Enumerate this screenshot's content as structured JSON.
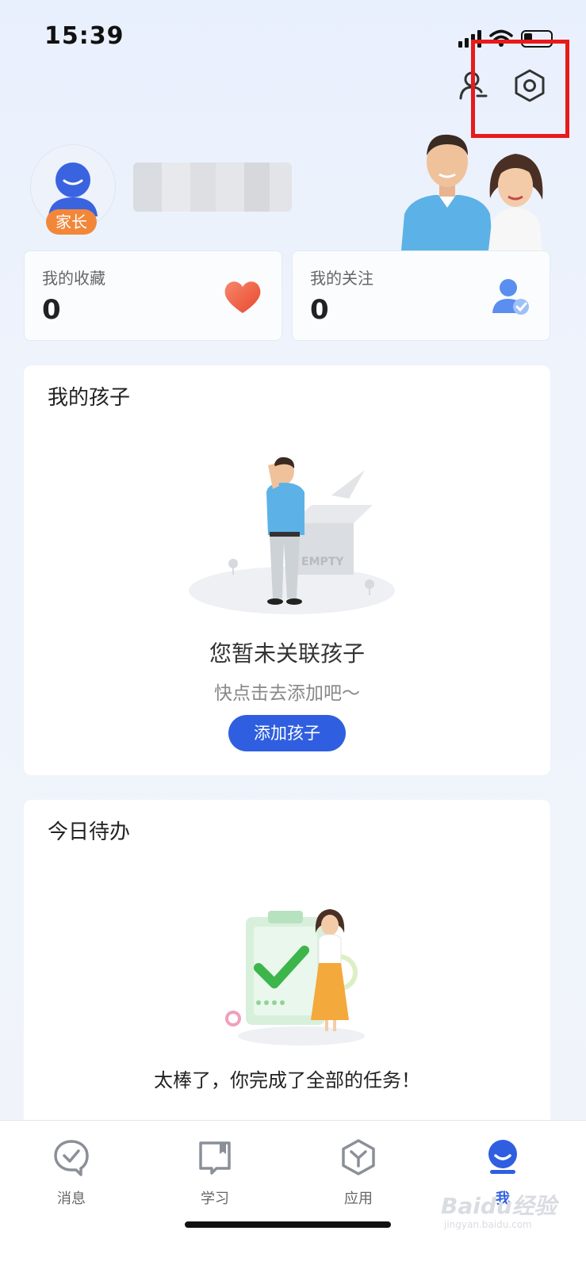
{
  "status_bar": {
    "time": "15:39"
  },
  "profile": {
    "role_badge": "家长"
  },
  "stats": [
    {
      "label": "我的收藏",
      "value": "0",
      "icon": "heart-icon"
    },
    {
      "label": "我的关注",
      "value": "0",
      "icon": "follow-user-icon"
    }
  ],
  "children_card": {
    "title": "我的孩子",
    "empty_title": "您暂未关联孩子",
    "empty_subtitle": "快点击去添加吧～",
    "add_button": "添加孩子",
    "illustration_text": "EMPTY"
  },
  "todo_card": {
    "title": "今日待办",
    "done_message": "太棒了，你完成了全部的任务！"
  },
  "bottom_nav": [
    {
      "label": "消息",
      "icon": "message-check-icon"
    },
    {
      "label": "学习",
      "icon": "book-icon"
    },
    {
      "label": "应用",
      "icon": "hexagon-app-icon"
    },
    {
      "label": "我",
      "icon": "profile-icon",
      "active": true
    }
  ],
  "watermark": {
    "main": "Baidu经验",
    "sub": "jingyan.baidu.com"
  },
  "colors": {
    "accent": "#2f5fe0",
    "badge": "#f2873a",
    "heart": "#ee5a3c",
    "highlight": "#e81a1a"
  }
}
